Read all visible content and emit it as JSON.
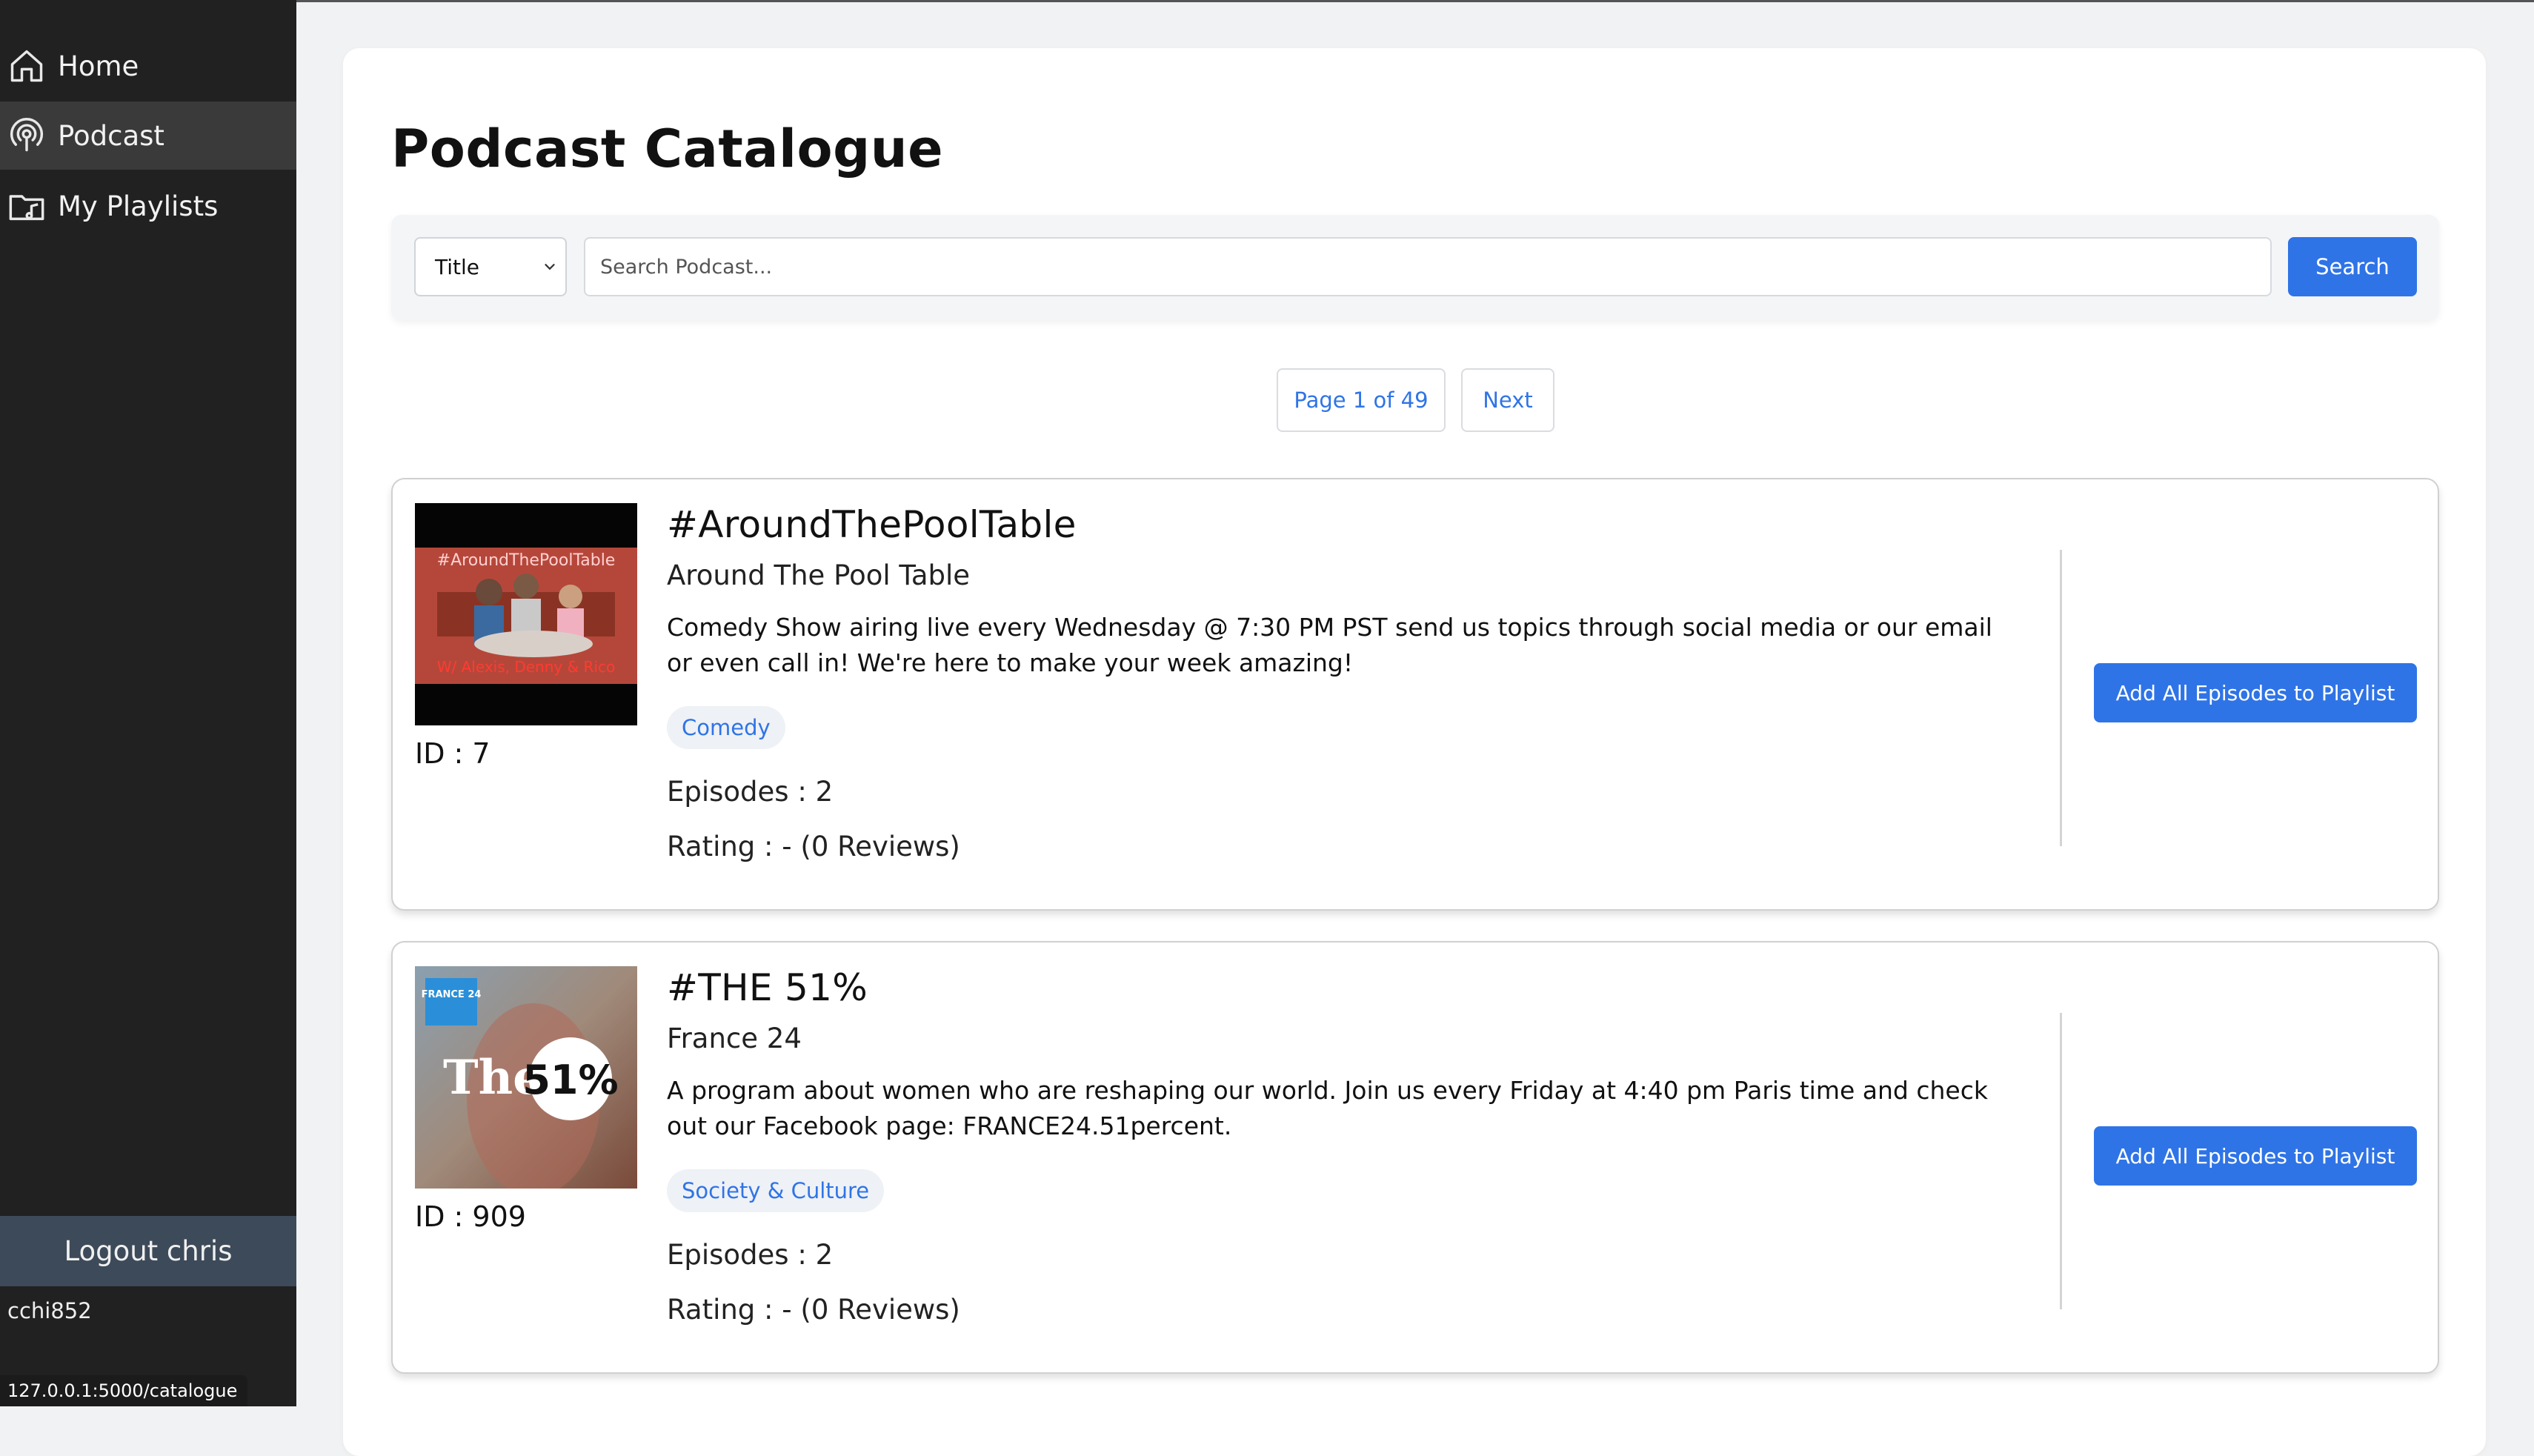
{
  "sidebar": {
    "items": [
      {
        "label": "Home",
        "icon": "home-icon"
      },
      {
        "label": "Podcast",
        "icon": "podcast-icon",
        "active": true
      },
      {
        "label": "My Playlists",
        "icon": "playlist-icon"
      }
    ],
    "logout_label": "Logout chris",
    "username": "cchi852"
  },
  "status_url": "127.0.0.1:5000/catalogue",
  "main": {
    "title": "Podcast Catalogue",
    "search": {
      "filter_selected": "Title",
      "placeholder": "Search Podcast...",
      "button_label": "Search"
    },
    "pagination": {
      "page_label": "Page 1 of 49",
      "next_label": "Next"
    },
    "podcasts": [
      {
        "title": "#AroundThePoolTable",
        "author": "Around The Pool Table",
        "description": "Comedy Show airing live every Wednesday @ 7:30 PM PST send us topics through social media or our email or even call in! We're here to make your week amazing!",
        "category": "Comedy",
        "id_label": "ID : 7",
        "episodes_label": "Episodes : 2",
        "rating_label": "Rating : - (0 Reviews)",
        "add_label": "Add All Episodes to Playlist",
        "thumb_text_top": "#AroundThePoolTable",
        "thumb_text_bottom": "W/ Alexis, Denny & Rico"
      },
      {
        "title": "#THE 51%",
        "author": "France 24",
        "description": "A program about women who are reshaping our world. Join us every Friday at 4:40 pm Paris time and check out our Facebook page: FRANCE24.51percent.",
        "category": "Society & Culture",
        "id_label": "ID : 909",
        "episodes_label": "Episodes : 2",
        "rating_label": "Rating : - (0 Reviews)",
        "add_label": "Add All Episodes to Playlist",
        "thumb_text_left": "The",
        "thumb_text_circle": "51%",
        "thumb_logo": "FRANCE 24"
      }
    ]
  },
  "colors": {
    "accent": "#2f74e6",
    "sidebar_bg": "#212121",
    "logout_bg": "#3d4a5a"
  }
}
